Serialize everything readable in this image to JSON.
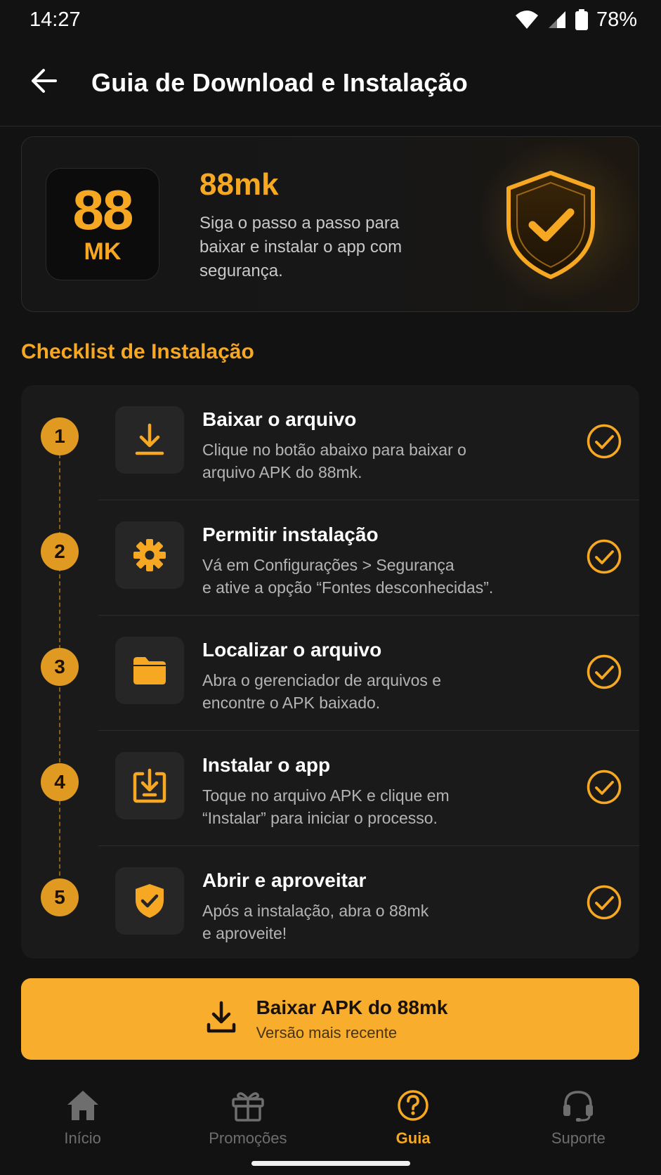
{
  "status_bar": {
    "time": "14:27",
    "battery": "78%"
  },
  "header": {
    "title": "Guia de Download e Instalação"
  },
  "hero": {
    "logo_top": "88",
    "logo_bottom": "MK",
    "title": "88mk",
    "description": "Siga o passo a passo para baixar e instalar o app com segurança."
  },
  "checklist": {
    "title": "Checklist de Instalação",
    "steps": [
      {
        "number": "1",
        "icon": "download-icon",
        "title": "Baixar o arquivo",
        "line1": "Clique no botão abaixo para baixar o",
        "line2": "arquivo APK do 88mk.",
        "done": true
      },
      {
        "number": "2",
        "icon": "gear-icon",
        "title": "Permitir instalação",
        "line1": "Vá em Configurações > Segurança",
        "line2": "e ative a opção “Fontes desconhecidas”.",
        "done": true
      },
      {
        "number": "3",
        "icon": "folder-icon",
        "title": "Localizar o arquivo",
        "line1": "Abra o gerenciador de arquivos e",
        "line2": "encontre o APK baixado.",
        "done": true
      },
      {
        "number": "4",
        "icon": "install-icon",
        "title": "Instalar o app",
        "line1": "Toque no arquivo APK e clique em",
        "line2": "“Instalar” para iniciar o processo.",
        "done": true
      },
      {
        "number": "5",
        "icon": "shield-check-icon",
        "title": "Abrir e aproveitar",
        "line1": "Após a instalação, abra o 88mk",
        "line2": "e aproveite!",
        "done": true
      }
    ]
  },
  "cta": {
    "label": "Baixar APK do 88mk",
    "sublabel": "Versão mais recente"
  },
  "bottom_nav": {
    "items": [
      {
        "label": "Início",
        "icon": "home-icon",
        "active": false
      },
      {
        "label": "Promoções",
        "icon": "gift-icon",
        "active": false
      },
      {
        "label": "Guia",
        "icon": "help-icon",
        "active": true
      },
      {
        "label": "Suporte",
        "icon": "headset-icon",
        "active": false
      }
    ]
  },
  "colors": {
    "accent": "#f6a823",
    "background": "#121212",
    "card": "#1a1a1a",
    "muted": "#6e6e6e"
  }
}
